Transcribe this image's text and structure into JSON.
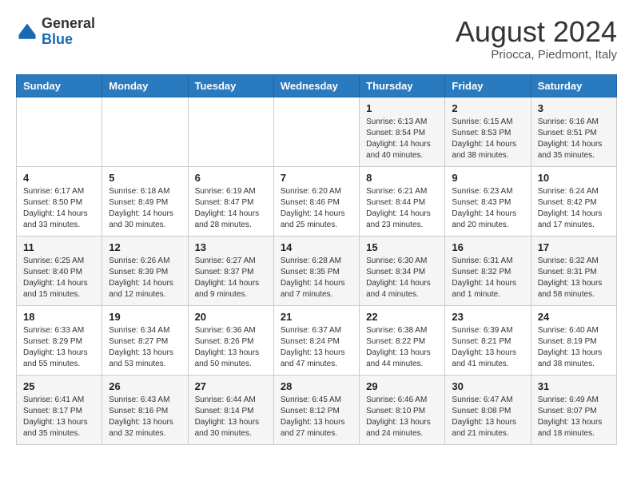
{
  "header": {
    "logo_general": "General",
    "logo_blue": "Blue",
    "main_title": "August 2024",
    "subtitle": "Priocca, Piedmont, Italy"
  },
  "weekdays": [
    "Sunday",
    "Monday",
    "Tuesday",
    "Wednesday",
    "Thursday",
    "Friday",
    "Saturday"
  ],
  "weeks": [
    [
      {
        "day": "",
        "info": ""
      },
      {
        "day": "",
        "info": ""
      },
      {
        "day": "",
        "info": ""
      },
      {
        "day": "",
        "info": ""
      },
      {
        "day": "1",
        "info": "Sunrise: 6:13 AM\nSunset: 8:54 PM\nDaylight: 14 hours\nand 40 minutes."
      },
      {
        "day": "2",
        "info": "Sunrise: 6:15 AM\nSunset: 8:53 PM\nDaylight: 14 hours\nand 38 minutes."
      },
      {
        "day": "3",
        "info": "Sunrise: 6:16 AM\nSunset: 8:51 PM\nDaylight: 14 hours\nand 35 minutes."
      }
    ],
    [
      {
        "day": "4",
        "info": "Sunrise: 6:17 AM\nSunset: 8:50 PM\nDaylight: 14 hours\nand 33 minutes."
      },
      {
        "day": "5",
        "info": "Sunrise: 6:18 AM\nSunset: 8:49 PM\nDaylight: 14 hours\nand 30 minutes."
      },
      {
        "day": "6",
        "info": "Sunrise: 6:19 AM\nSunset: 8:47 PM\nDaylight: 14 hours\nand 28 minutes."
      },
      {
        "day": "7",
        "info": "Sunrise: 6:20 AM\nSunset: 8:46 PM\nDaylight: 14 hours\nand 25 minutes."
      },
      {
        "day": "8",
        "info": "Sunrise: 6:21 AM\nSunset: 8:44 PM\nDaylight: 14 hours\nand 23 minutes."
      },
      {
        "day": "9",
        "info": "Sunrise: 6:23 AM\nSunset: 8:43 PM\nDaylight: 14 hours\nand 20 minutes."
      },
      {
        "day": "10",
        "info": "Sunrise: 6:24 AM\nSunset: 8:42 PM\nDaylight: 14 hours\nand 17 minutes."
      }
    ],
    [
      {
        "day": "11",
        "info": "Sunrise: 6:25 AM\nSunset: 8:40 PM\nDaylight: 14 hours\nand 15 minutes."
      },
      {
        "day": "12",
        "info": "Sunrise: 6:26 AM\nSunset: 8:39 PM\nDaylight: 14 hours\nand 12 minutes."
      },
      {
        "day": "13",
        "info": "Sunrise: 6:27 AM\nSunset: 8:37 PM\nDaylight: 14 hours\nand 9 minutes."
      },
      {
        "day": "14",
        "info": "Sunrise: 6:28 AM\nSunset: 8:35 PM\nDaylight: 14 hours\nand 7 minutes."
      },
      {
        "day": "15",
        "info": "Sunrise: 6:30 AM\nSunset: 8:34 PM\nDaylight: 14 hours\nand 4 minutes."
      },
      {
        "day": "16",
        "info": "Sunrise: 6:31 AM\nSunset: 8:32 PM\nDaylight: 14 hours\nand 1 minute."
      },
      {
        "day": "17",
        "info": "Sunrise: 6:32 AM\nSunset: 8:31 PM\nDaylight: 13 hours\nand 58 minutes."
      }
    ],
    [
      {
        "day": "18",
        "info": "Sunrise: 6:33 AM\nSunset: 8:29 PM\nDaylight: 13 hours\nand 55 minutes."
      },
      {
        "day": "19",
        "info": "Sunrise: 6:34 AM\nSunset: 8:27 PM\nDaylight: 13 hours\nand 53 minutes."
      },
      {
        "day": "20",
        "info": "Sunrise: 6:36 AM\nSunset: 8:26 PM\nDaylight: 13 hours\nand 50 minutes."
      },
      {
        "day": "21",
        "info": "Sunrise: 6:37 AM\nSunset: 8:24 PM\nDaylight: 13 hours\nand 47 minutes."
      },
      {
        "day": "22",
        "info": "Sunrise: 6:38 AM\nSunset: 8:22 PM\nDaylight: 13 hours\nand 44 minutes."
      },
      {
        "day": "23",
        "info": "Sunrise: 6:39 AM\nSunset: 8:21 PM\nDaylight: 13 hours\nand 41 minutes."
      },
      {
        "day": "24",
        "info": "Sunrise: 6:40 AM\nSunset: 8:19 PM\nDaylight: 13 hours\nand 38 minutes."
      }
    ],
    [
      {
        "day": "25",
        "info": "Sunrise: 6:41 AM\nSunset: 8:17 PM\nDaylight: 13 hours\nand 35 minutes."
      },
      {
        "day": "26",
        "info": "Sunrise: 6:43 AM\nSunset: 8:16 PM\nDaylight: 13 hours\nand 32 minutes."
      },
      {
        "day": "27",
        "info": "Sunrise: 6:44 AM\nSunset: 8:14 PM\nDaylight: 13 hours\nand 30 minutes."
      },
      {
        "day": "28",
        "info": "Sunrise: 6:45 AM\nSunset: 8:12 PM\nDaylight: 13 hours\nand 27 minutes."
      },
      {
        "day": "29",
        "info": "Sunrise: 6:46 AM\nSunset: 8:10 PM\nDaylight: 13 hours\nand 24 minutes."
      },
      {
        "day": "30",
        "info": "Sunrise: 6:47 AM\nSunset: 8:08 PM\nDaylight: 13 hours\nand 21 minutes."
      },
      {
        "day": "31",
        "info": "Sunrise: 6:49 AM\nSunset: 8:07 PM\nDaylight: 13 hours\nand 18 minutes."
      }
    ]
  ]
}
